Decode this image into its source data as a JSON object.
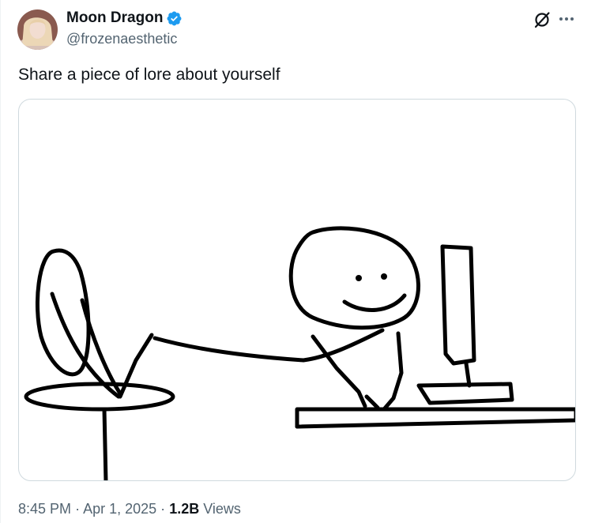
{
  "tweet": {
    "author": {
      "display_name": "Moon Dragon",
      "handle": "@frozenaesthetic",
      "verified": true,
      "avatar": "avatar-photo"
    },
    "text": "Share a piece of lore about yourself",
    "media": {
      "type": "image",
      "description_icon": "stick-figure-at-computer-drawing"
    },
    "meta": {
      "time": "8:45 PM",
      "separator": "·",
      "date": "Apr 1, 2025",
      "views_count": "1.2B",
      "views_label": "Views"
    },
    "actions": {
      "grok_icon": "grok-icon",
      "more_icon": "more-icon"
    }
  },
  "colors": {
    "text_primary": "#0f1419",
    "text_secondary": "#536471",
    "verified_blue": "#1d9bf0",
    "border": "#cfd9de"
  }
}
